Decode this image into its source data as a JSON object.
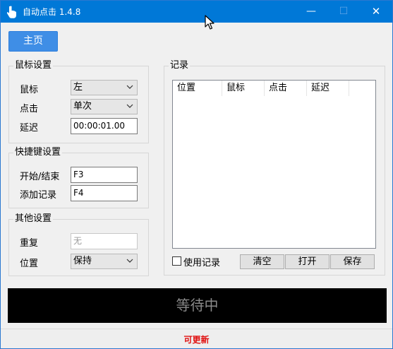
{
  "window": {
    "title": "自动点击 1.4.8",
    "minimize": "—",
    "maximize": "☐",
    "close": "✕"
  },
  "nav": {
    "home_label": "主页"
  },
  "mouse_settings": {
    "title": "鼠标设置",
    "mouse_label": "鼠标",
    "mouse_value": "左",
    "click_label": "点击",
    "click_value": "单次",
    "delay_label": "延迟",
    "delay_value": "00:00:01.00"
  },
  "hotkey_settings": {
    "title": "快捷键设置",
    "start_stop_label": "开始/结束",
    "start_stop_value": "F3",
    "add_record_label": "添加记录",
    "add_record_value": "F4"
  },
  "other_settings": {
    "title": "其他设置",
    "repeat_label": "重复",
    "repeat_placeholder": "无",
    "position_label": "位置",
    "position_value": "保持"
  },
  "records": {
    "title": "记录",
    "columns": [
      "位置",
      "鼠标",
      "点击",
      "延迟"
    ],
    "use_records_label": "使用记录",
    "clear_label": "清空",
    "open_label": "打开",
    "save_label": "保存"
  },
  "status": {
    "text": "等待中"
  },
  "footer": {
    "update_text": "可更新"
  },
  "colors": {
    "titlebar": "#0078d7",
    "accent_button": "#3f8ee6",
    "status_bg": "#000000",
    "update_text": "#e01010"
  },
  "icons": {
    "app": "hand-pointer-icon",
    "cursor": "mouse-cursor-icon",
    "dropdown": "chevron-down-icon"
  }
}
